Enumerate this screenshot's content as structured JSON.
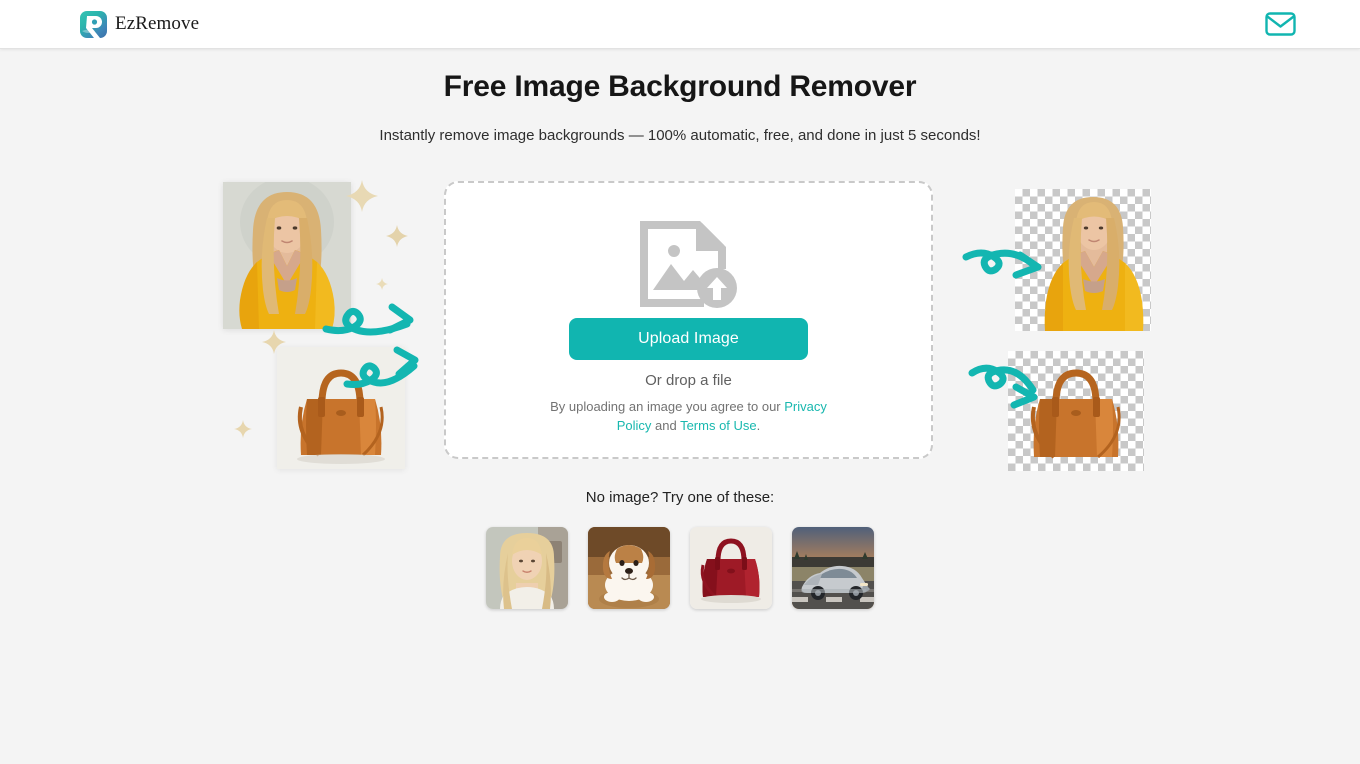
{
  "header": {
    "brand_name": "EzRemove",
    "logo_icon": "ezremove-r-logo",
    "mail_icon": "mail-envelope-icon",
    "accent_color": "#11b5b0"
  },
  "hero": {
    "title": "Free Image Background Remover",
    "subtitle": "Instantly remove image backgrounds — 100% automatic, free, and done in just 5 seconds!"
  },
  "dropzone": {
    "upload_illustration_icon": "image-upload-icon",
    "upload_button_label": "Upload Image",
    "drop_hint": "Or drop a file",
    "legal_prefix": "By uploading an image you agree to our ",
    "privacy_link": "Privacy Policy",
    "legal_middle": " and ",
    "terms_link": "Terms of Use",
    "legal_suffix": "."
  },
  "showcase": {
    "before_label": "original images with background",
    "after_label": "images with background removed",
    "arrow_icon": "curly-arrow-icon",
    "sparkle_icon": "sparkle-icon",
    "items": [
      {
        "name": "woman-in-yellow-jacket",
        "state": "before"
      },
      {
        "name": "brown-leather-handbag",
        "state": "before"
      },
      {
        "name": "woman-in-yellow-jacket",
        "state": "after"
      },
      {
        "name": "brown-leather-handbag",
        "state": "after"
      }
    ]
  },
  "samples": {
    "label": "No image? Try one of these:",
    "items": [
      {
        "name": "sample-blonde-woman-portrait"
      },
      {
        "name": "sample-puppy-dog"
      },
      {
        "name": "sample-red-handbag"
      },
      {
        "name": "sample-silver-sports-car"
      }
    ]
  }
}
